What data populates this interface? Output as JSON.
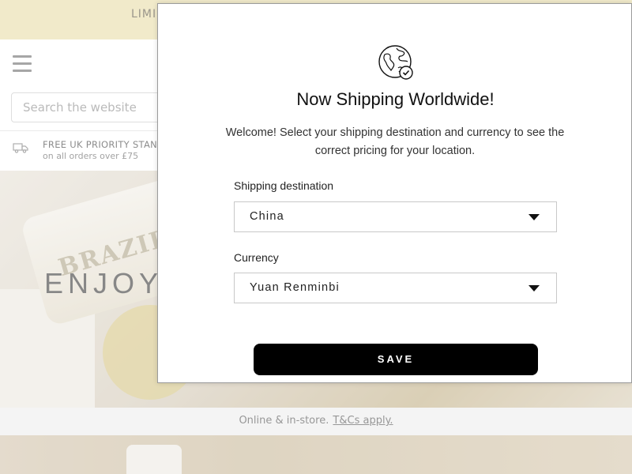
{
  "promo_bar": {
    "text": "LIMI"
  },
  "header": {
    "search_placeholder": "Search the website"
  },
  "delivery": {
    "title": "FREE UK PRIORITY STAND",
    "subtitle": "on all orders over £75"
  },
  "hero": {
    "jar_label": "BRAZILIAN B",
    "text": "ENJOY"
  },
  "terms_bar": {
    "text": "Online & in-store.",
    "link": "T&Cs apply."
  },
  "modal": {
    "title": "Now Shipping Worldwide!",
    "description": "Welcome! Select your shipping destination and currency to see the correct pricing for your location.",
    "shipping_label": "Shipping destination",
    "shipping_value": "China",
    "currency_label": "Currency",
    "currency_value": "Yuan Renminbi",
    "save_label": "SAVE"
  },
  "colors": {
    "promo_bar": "#ebe0b2",
    "button": "#000000",
    "button_text": "#ffffff"
  },
  "icons": {
    "globe": "globe-check-icon",
    "menu": "hamburger-menu-icon",
    "truck": "truck-icon",
    "caret": "caret-down-icon"
  }
}
